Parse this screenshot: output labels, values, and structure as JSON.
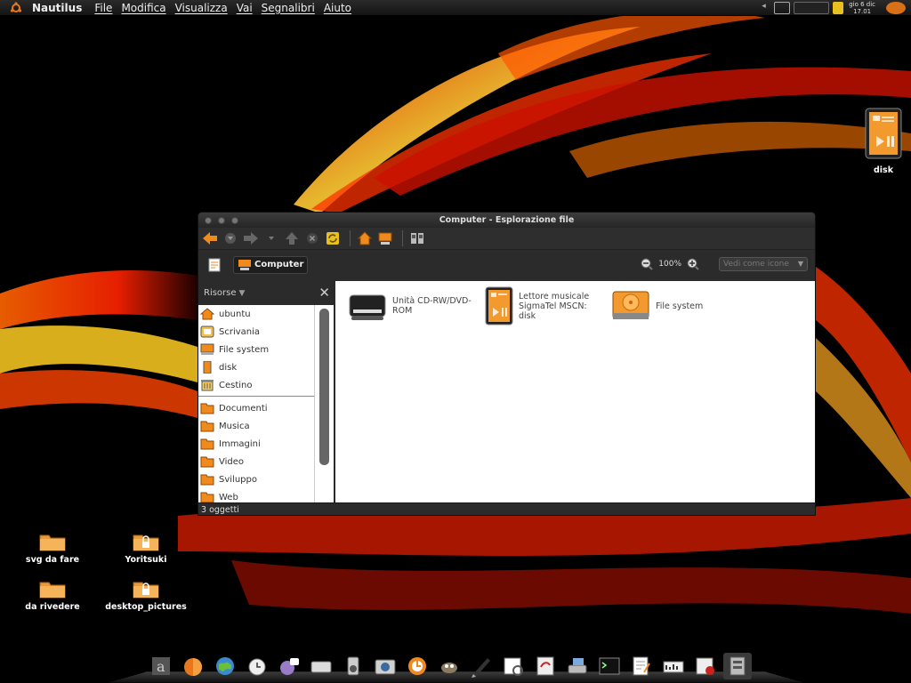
{
  "top_panel": {
    "app_name": "Nautilus",
    "menus": [
      "File",
      "Modifica",
      "Visualizza",
      "Vai",
      "Segnalibri",
      "Aiuto"
    ],
    "clock": {
      "date": "gio  6 dic",
      "time": "17.01"
    }
  },
  "desktop": {
    "right_icon": {
      "label": "disk"
    },
    "icons": [
      {
        "label": "svg da fare"
      },
      {
        "label": "Yoritsuki"
      },
      {
        "label": "da rivedere"
      },
      {
        "label": "desktop_pictures"
      }
    ]
  },
  "window": {
    "title": "Computer - Esplorazione file",
    "location": {
      "crumb": "Computer"
    },
    "zoom": {
      "level": "100%"
    },
    "view_select": {
      "placeholder": "Vedi come icone"
    },
    "sidebar": {
      "header": "Risorse",
      "places": [
        {
          "label": "ubuntu",
          "icon": "home-icon"
        },
        {
          "label": "Scrivania",
          "icon": "desktop-icon"
        },
        {
          "label": "File system",
          "icon": "filesystem-icon"
        },
        {
          "label": "disk",
          "icon": "media-player-icon"
        },
        {
          "label": "Cestino",
          "icon": "trash-icon"
        }
      ],
      "bookmarks": [
        {
          "label": "Documenti"
        },
        {
          "label": "Musica"
        },
        {
          "label": "Immagini"
        },
        {
          "label": "Video"
        },
        {
          "label": "Sviluppo"
        },
        {
          "label": "Web"
        }
      ]
    },
    "items": [
      {
        "label": "Unità CD-RW/DVD-ROM",
        "icon": "optical-drive-icon"
      },
      {
        "label": "Lettore musicale SigmaTel MSCN: disk",
        "icon": "media-player-icon"
      },
      {
        "label": "File system",
        "icon": "hard-disk-icon"
      }
    ],
    "status": "3 oggetti"
  },
  "colors": {
    "accent": "#f08a1c",
    "folder": "#e88a20"
  }
}
